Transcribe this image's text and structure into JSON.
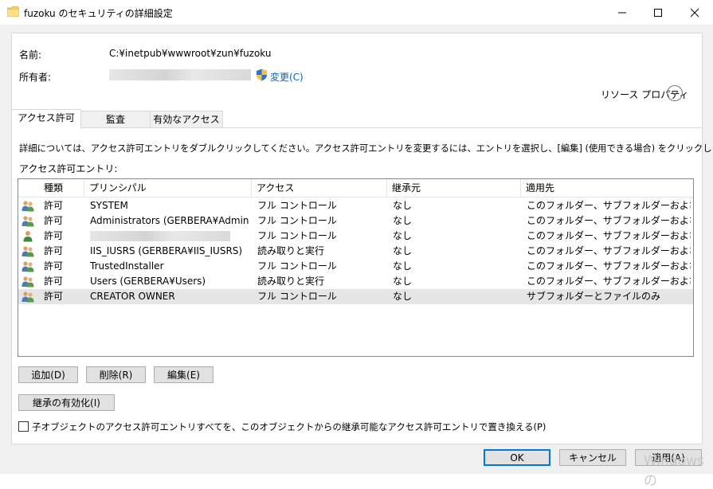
{
  "window": {
    "title": "fuzoku のセキュリティの詳細設定",
    "minimize_glyph": "—",
    "maximize_glyph": "☐",
    "close_glyph": "✕"
  },
  "info": {
    "name_label": "名前:",
    "name_value": "C:¥inetpub¥wwwroot¥zun¥fuzoku",
    "owner_label": "所有者:",
    "change_link": "変更(C)",
    "resource_properties": "リソース プロパティ"
  },
  "tabs": [
    {
      "label": "アクセス許可",
      "active": true
    },
    {
      "label": "監査",
      "active": false
    },
    {
      "label": "有効なアクセス",
      "active": false
    }
  ],
  "instructions": "詳細については、アクセス許可エントリをダブルクリックしてください。アクセス許可エントリを変更するには、エントリを選択し、[編集] (使用できる場合) をクリックします。",
  "entries_label": "アクセス許可エントリ:",
  "table": {
    "columns": [
      "種類",
      "プリンシパル",
      "アクセス",
      "継承元",
      "適用先"
    ],
    "rows": [
      {
        "type": "許可",
        "principal": "SYSTEM",
        "access": "フル コントロール",
        "inherited": "なし",
        "applies": "このフォルダー、サブフォルダーおよびファイル",
        "icon": "users-icon"
      },
      {
        "type": "許可",
        "principal": "Administrators (GERBERA¥Administr...",
        "access": "フル コントロール",
        "inherited": "なし",
        "applies": "このフォルダー、サブフォルダーおよびファイル",
        "icon": "users-icon"
      },
      {
        "type": "許可",
        "principal": "",
        "access": "フル コントロール",
        "inherited": "なし",
        "applies": "このフォルダー、サブフォルダーおよびファイル",
        "icon": "user-icon"
      },
      {
        "type": "許可",
        "principal": "IIS_IUSRS (GERBERA¥IIS_IUSRS)",
        "access": "読み取りと実行",
        "inherited": "なし",
        "applies": "このフォルダー、サブフォルダーおよびファイル",
        "icon": "users-icon"
      },
      {
        "type": "許可",
        "principal": "TrustedInstaller",
        "access": "フル コントロール",
        "inherited": "なし",
        "applies": "このフォルダー、サブフォルダーおよびファイル",
        "icon": "users-icon"
      },
      {
        "type": "許可",
        "principal": "Users (GERBERA¥Users)",
        "access": "読み取りと実行",
        "inherited": "なし",
        "applies": "このフォルダー、サブフォルダーおよびファイル",
        "icon": "users-icon"
      },
      {
        "type": "許可",
        "principal": "CREATOR OWNER",
        "access": "フル コントロール",
        "inherited": "なし",
        "applies": "サブフォルダーとファイルのみ",
        "icon": "users-icon",
        "selected": true
      }
    ]
  },
  "buttons": {
    "add": "追加(D)",
    "remove": "削除(R)",
    "edit": "編集(E)",
    "enable_inheritance": "継承の有効化(I)",
    "ok": "OK",
    "cancel": "キャンセル",
    "apply": "適用(A)"
  },
  "replace_checkbox": {
    "label": "子オブジェクトのアクセス許可エントリすべてを、このオブジェクトからの継承可能なアクセス許可エントリで置き換える(P)",
    "checked": false
  },
  "watermark": "Windows の",
  "colors": {
    "link": "#0066cc",
    "selection": "#e5e5e5",
    "accent": "#0078d7"
  }
}
